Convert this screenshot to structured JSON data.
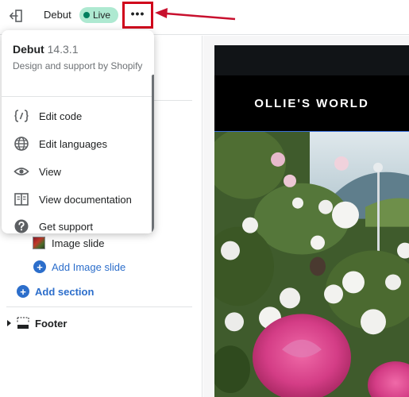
{
  "topbar": {
    "theme_name": "Debut",
    "status_badge": "Live",
    "more_actions_label": "•••"
  },
  "popover": {
    "theme_title": "Debut",
    "version": "14.3.1",
    "description": "Design and support by Shopify",
    "items": [
      {
        "label": "Edit code",
        "icon": "code-icon"
      },
      {
        "label": "Edit languages",
        "icon": "globe-icon"
      },
      {
        "label": "View",
        "icon": "eye-icon"
      },
      {
        "label": "View documentation",
        "icon": "book-icon"
      },
      {
        "label": "Get support",
        "icon": "question-circle-icon"
      }
    ]
  },
  "sidebar": {
    "image_slide_label": "Image slide",
    "add_image_slide_label": "Add Image slide",
    "add_section_label": "Add section",
    "footer_label": "Footer"
  },
  "preview": {
    "store_name": "OLLIE'S WORLD"
  },
  "colors": {
    "live_badge_bg": "#aee9d1",
    "live_dot": "#007f5f",
    "link_blue": "#2c6ecb",
    "annotation_red": "#d0021b"
  }
}
